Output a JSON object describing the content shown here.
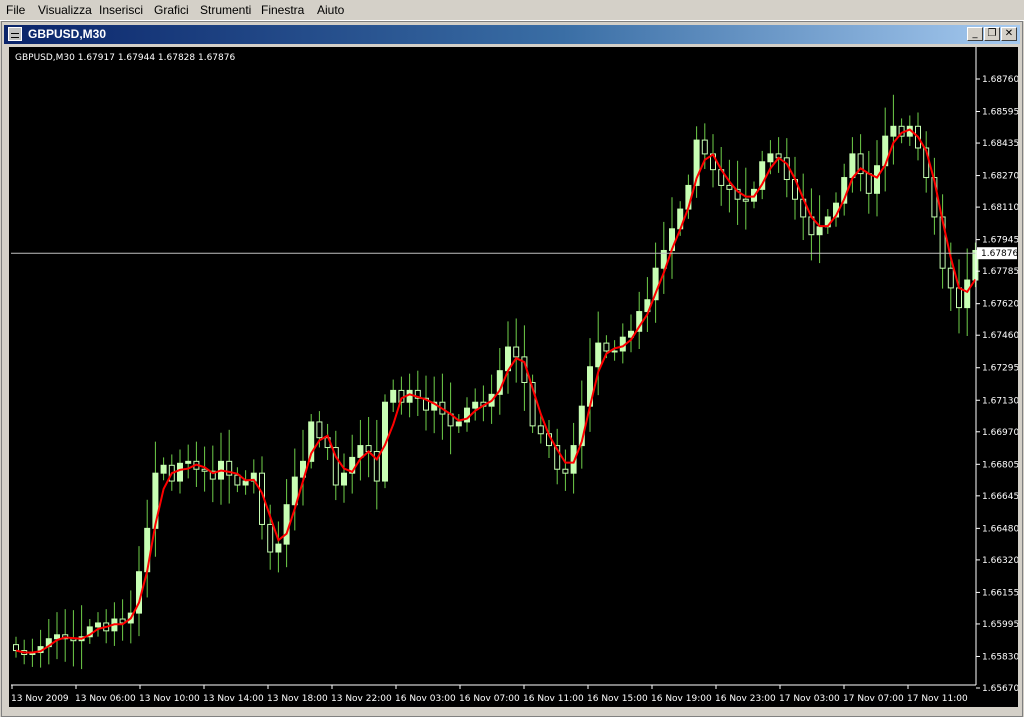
{
  "menu": [
    "File",
    "Visualizza",
    "Inserisci",
    "Grafici",
    "Strumenti",
    "Finestra",
    "Aiuto"
  ],
  "window": {
    "title": "GBPUSD,M30",
    "minimize_glyph": "_",
    "restore_glyph": "❐",
    "close_glyph": "✕"
  },
  "chart_info": "GBPUSD,M30  1.67917 1.67944 1.67828 1.67876",
  "current_price": "1.67876",
  "price_labels": [
    "1.68760",
    "1.68595",
    "1.68435",
    "1.68270",
    "1.68110",
    "1.67945",
    "1.67785",
    "1.67620",
    "1.67460",
    "1.67295",
    "1.67130",
    "1.66970",
    "1.66805",
    "1.66645",
    "1.66480",
    "1.66320",
    "1.66155",
    "1.65995",
    "1.65830",
    "1.65670"
  ],
  "time_labels": [
    "13 Nov 2009",
    "13 Nov 06:00",
    "13 Nov 10:00",
    "13 Nov 14:00",
    "13 Nov 18:00",
    "13 Nov 22:00",
    "16 Nov 03:00",
    "16 Nov 07:00",
    "16 Nov 11:00",
    "16 Nov 15:00",
    "16 Nov 19:00",
    "16 Nov 23:00",
    "17 Nov 03:00",
    "17 Nov 07:00",
    "17 Nov 11:00"
  ],
  "colors": {
    "background": "#000000",
    "candle": "#c8ffb4",
    "wick": "#6fcf4a",
    "moving_average": "#ff0000",
    "axis_text": "#ffffff",
    "price_line": "#c0c0c0",
    "title_bar_start": "#0a246a"
  },
  "chart_data": {
    "type": "candlestick",
    "symbol": "GBPUSD",
    "timeframe": "M30",
    "ohlc_last": {
      "open": 1.67917,
      "high": 1.67944,
      "low": 1.67828,
      "close": 1.67876
    },
    "ylim": [
      1.6567,
      1.6876
    ],
    "price_tick_labels": [
      "1.68760",
      "1.68595",
      "1.68435",
      "1.68270",
      "1.68110",
      "1.67945",
      "1.67785",
      "1.67620",
      "1.67460",
      "1.67295",
      "1.67130",
      "1.66970",
      "1.66805",
      "1.66645",
      "1.66480",
      "1.66320",
      "1.66155",
      "1.65995",
      "1.65830",
      "1.65670"
    ],
    "time_tick_labels": [
      "13 Nov 2009",
      "13 Nov 06:00",
      "13 Nov 10:00",
      "13 Nov 14:00",
      "13 Nov 18:00",
      "13 Nov 22:00",
      "16 Nov 03:00",
      "16 Nov 07:00",
      "16 Nov 11:00",
      "16 Nov 15:00",
      "16 Nov 19:00",
      "16 Nov 23:00",
      "17 Nov 03:00",
      "17 Nov 07:00",
      "17 Nov 11:00"
    ],
    "closes": [
      1.6586,
      1.6584,
      1.6585,
      1.6588,
      1.6592,
      1.6594,
      1.6592,
      1.6591,
      1.6593,
      1.6598,
      1.66,
      1.6596,
      1.6602,
      1.66,
      1.6605,
      1.6626,
      1.6648,
      1.6676,
      1.668,
      1.6672,
      1.6681,
      1.6682,
      1.6678,
      1.6677,
      1.6673,
      1.6682,
      1.6675,
      1.667,
      1.6672,
      1.6676,
      1.665,
      1.6636,
      1.664,
      1.666,
      1.6674,
      1.6682,
      1.6702,
      1.6694,
      1.6689,
      1.667,
      1.6676,
      1.6684,
      1.669,
      1.6687,
      1.6672,
      1.6712,
      1.6718,
      1.6712,
      1.6718,
      1.6714,
      1.6708,
      1.6712,
      1.6706,
      1.67,
      1.6702,
      1.6709,
      1.6712,
      1.671,
      1.6716,
      1.6728,
      1.674,
      1.6735,
      1.6722,
      1.67,
      1.6696,
      1.669,
      1.6678,
      1.6676,
      1.669,
      1.671,
      1.673,
      1.6742,
      1.6738,
      1.6738,
      1.6745,
      1.6748,
      1.6758,
      1.6764,
      1.678,
      1.6789,
      1.68,
      1.681,
      1.6822,
      1.6845,
      1.6838,
      1.683,
      1.6822,
      1.682,
      1.6815,
      1.6814,
      1.682,
      1.6834,
      1.6838,
      1.6836,
      1.6825,
      1.6815,
      1.6806,
      1.6797,
      1.6801,
      1.6806,
      1.6813,
      1.6826,
      1.6838,
      1.6828,
      1.6818,
      1.6832,
      1.6847,
      1.6852,
      1.6847,
      1.6852,
      1.6841,
      1.6826,
      1.6806,
      1.678,
      1.677,
      1.676,
      1.6774,
      1.6789
    ],
    "moving_average": {
      "label": "",
      "color": "#ff0000"
    }
  }
}
